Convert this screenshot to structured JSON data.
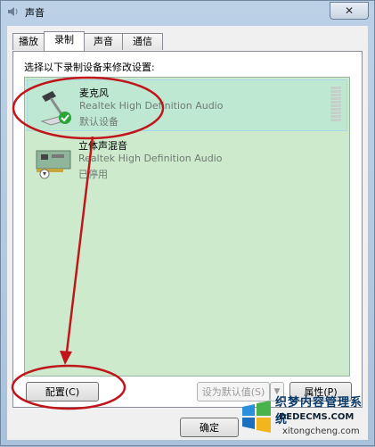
{
  "window": {
    "title": "声音",
    "close_symbol": "✕"
  },
  "tabs": [
    {
      "label": "播放",
      "active": false
    },
    {
      "label": "录制",
      "active": true
    },
    {
      "label": "声音",
      "active": false
    },
    {
      "label": "通信",
      "active": false
    }
  ],
  "panel": {
    "instruction": "选择以下录制设备来修改设置:"
  },
  "devices": [
    {
      "name": "麦克风",
      "driver": "Realtek High Definition Audio",
      "status": "默认设备",
      "icon": "microphone-icon",
      "badge": "default-check-icon"
    },
    {
      "name": "立体声混音",
      "driver": "Realtek High Definition Audio",
      "status": "已停用",
      "icon": "sound-card-icon",
      "badge": "disabled-arrow-icon"
    }
  ],
  "buttons": {
    "configure": "配置(C)",
    "set_default": "设为默认值(S)",
    "properties": "属性(P)",
    "ok": "确定"
  },
  "watermark": {
    "text": "织梦内容管理系统",
    "url": "DEDECMS.COM",
    "url2": "xitongcheng.com"
  },
  "colors": {
    "annotation": "#c0161b",
    "list_background": "#cdeacc"
  }
}
